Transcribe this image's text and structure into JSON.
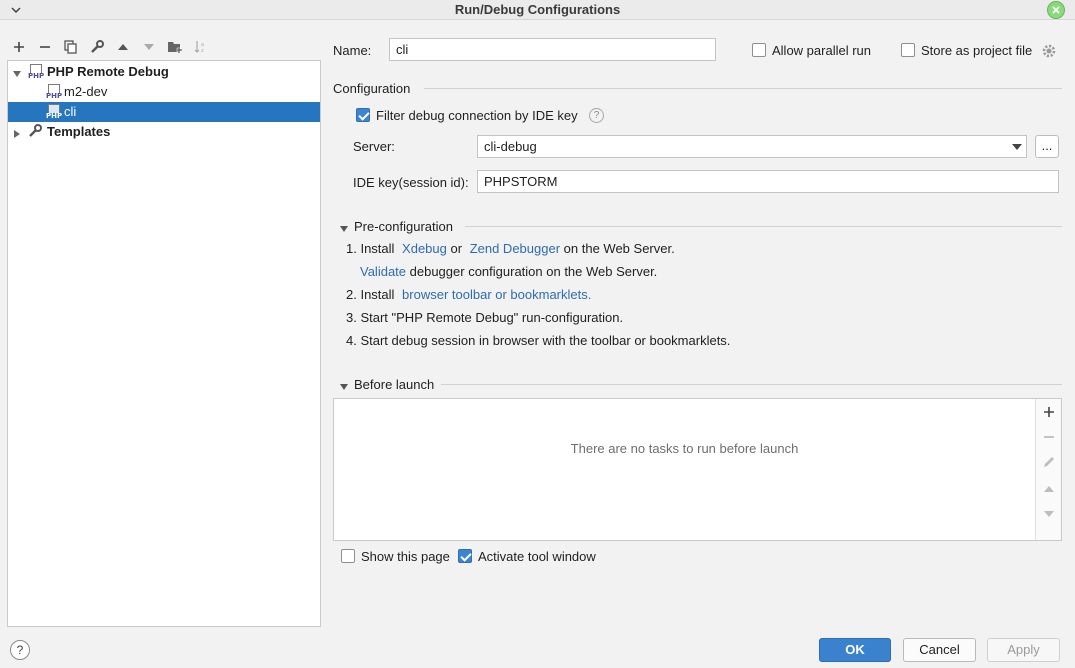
{
  "window": {
    "title": "Run/Debug Configurations"
  },
  "toolbar": {
    "icons": [
      "add-icon",
      "remove-icon",
      "copy-icon",
      "wrench-icon",
      "move-up-icon",
      "move-down-icon",
      "new-folder-icon",
      "sort-icon"
    ]
  },
  "tree": {
    "group_label": "PHP Remote Debug",
    "items": [
      {
        "label": "m2-dev"
      },
      {
        "label": "cli"
      }
    ],
    "templates_label": "Templates"
  },
  "form": {
    "name_label": "Name:",
    "name_value": "cli",
    "allow_parallel_label": "Allow parallel run",
    "store_project_label": "Store as project file",
    "configuration_title": "Configuration",
    "filter_label": "Filter debug connection by IDE key",
    "server_label": "Server:",
    "server_value": "cli-debug",
    "browse_label": "...",
    "ide_key_label": "IDE key(session id):",
    "ide_key_value": "PHPSTORM"
  },
  "preconfig": {
    "title": "Pre-configuration",
    "step1_prefix": "1. Install",
    "xdebug_link": "Xdebug",
    "or_text": "or",
    "zend_link": "Zend Debugger",
    "step1_suffix": "on the Web Server.",
    "validate_link": "Validate",
    "validate_suffix": "debugger configuration on the Web Server.",
    "step2_prefix": "2. Install",
    "toolbar_link": "browser toolbar or bookmarklets.",
    "step3": "3. Start \"PHP Remote Debug\" run-configuration.",
    "step4": "4. Start debug session in browser with the toolbar or bookmarklets."
  },
  "before_launch": {
    "title": "Before launch",
    "empty_message": "There are no tasks to run before launch",
    "show_page_label": "Show this page",
    "activate_tool_label": "Activate tool window"
  },
  "buttons": {
    "help_label": "?",
    "ok_label": "OK",
    "cancel_label": "Cancel",
    "apply_label": "Apply"
  },
  "colors": {
    "selection": "#2675bf",
    "link": "#2d6bb3",
    "primary_button": "#3a82ce",
    "close_button": "#8bd97a"
  }
}
